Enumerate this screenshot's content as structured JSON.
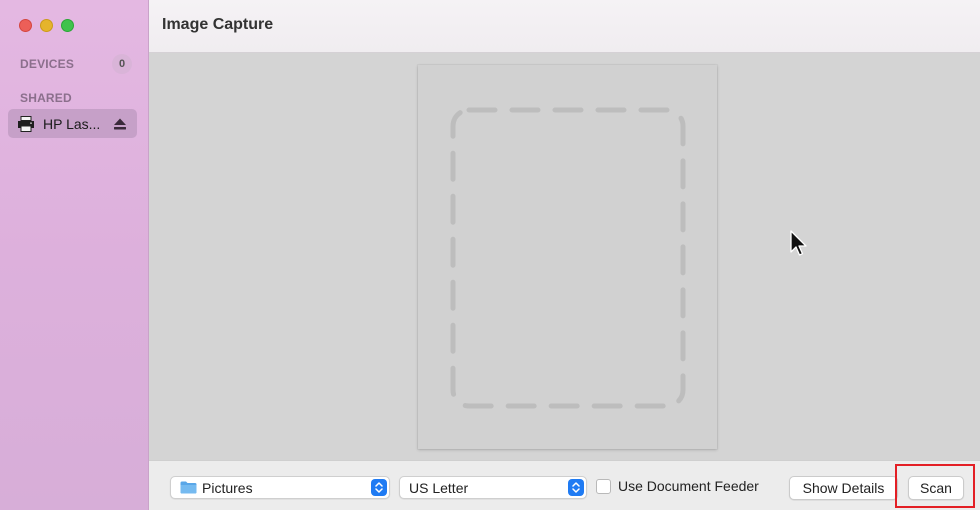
{
  "window": {
    "title": "Image Capture"
  },
  "sidebar": {
    "devices_label": "DEVICES",
    "devices_count": "0",
    "shared_label": "SHARED",
    "shared_items": [
      {
        "label": "HP Las...",
        "icon": "printer-icon",
        "action_icon": "eject-icon"
      }
    ]
  },
  "bottom_bar": {
    "destination": {
      "value": "Pictures",
      "icon": "folder-icon"
    },
    "paper_size": {
      "value": "US Letter"
    },
    "document_feeder": {
      "label": "Use Document Feeder",
      "checked": false
    },
    "show_details_label": "Show Details",
    "scan_label": "Scan"
  },
  "colors": {
    "sidebar_bg": "#e0b5df",
    "accent": "#1f7bf3",
    "highlight": "#e31f25"
  }
}
